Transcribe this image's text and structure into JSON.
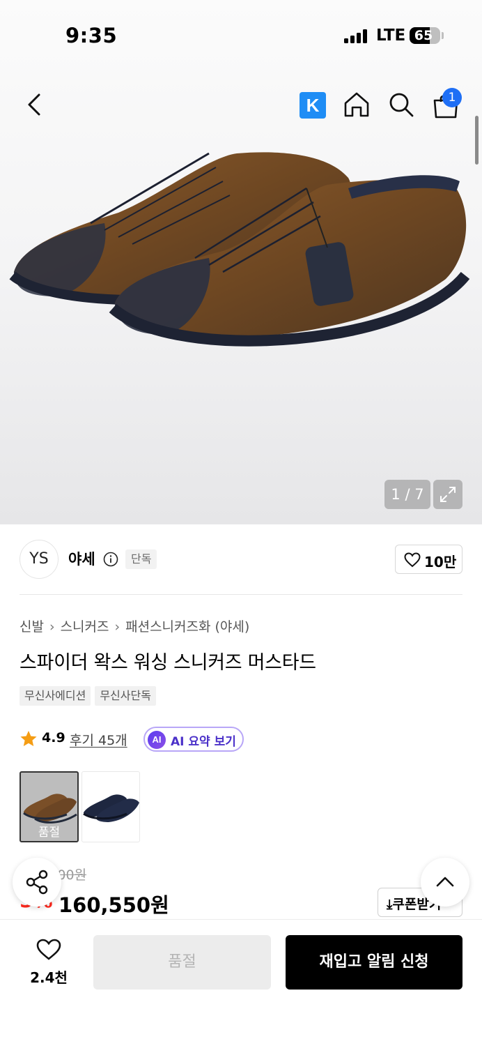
{
  "status_bar": {
    "time": "9:35",
    "network": "LTE",
    "battery": "65",
    "battery_level": 0.65
  },
  "header": {
    "k_badge": "K",
    "cart_count": "1"
  },
  "gallery": {
    "page_indicator": "1 / 7"
  },
  "brand": {
    "logo_text": "YS",
    "name": "야세",
    "badge": "단독",
    "likes": "10만"
  },
  "product": {
    "breadcrumb": [
      "신발",
      "스니커즈",
      "패션스니커즈화 (야세)"
    ],
    "title": "스파이더 왁스 워싱 스니커즈 머스타드",
    "tags": [
      "무신사에디션",
      "무신사단독"
    ],
    "rating": "4.9",
    "reviews": "후기 45개",
    "ai_badge": "AI",
    "ai_summary": "AI 요약 보기",
    "options": [
      {
        "name": "mustard",
        "status": "품절"
      },
      {
        "name": "navy",
        "status": ""
      }
    ],
    "original_price": "169,000원",
    "discount": "5%",
    "price": "160,550원",
    "coupon": "쿠폰받기"
  },
  "bottom_bar": {
    "wish_count": "2.4천",
    "soldout_label": "품절",
    "restock_label": "재입고 알림 신청"
  },
  "colors": {
    "accent_blue": "#1f6ff5",
    "discount_red": "#ff2a1f",
    "ai_purple": "#4b31c9"
  }
}
